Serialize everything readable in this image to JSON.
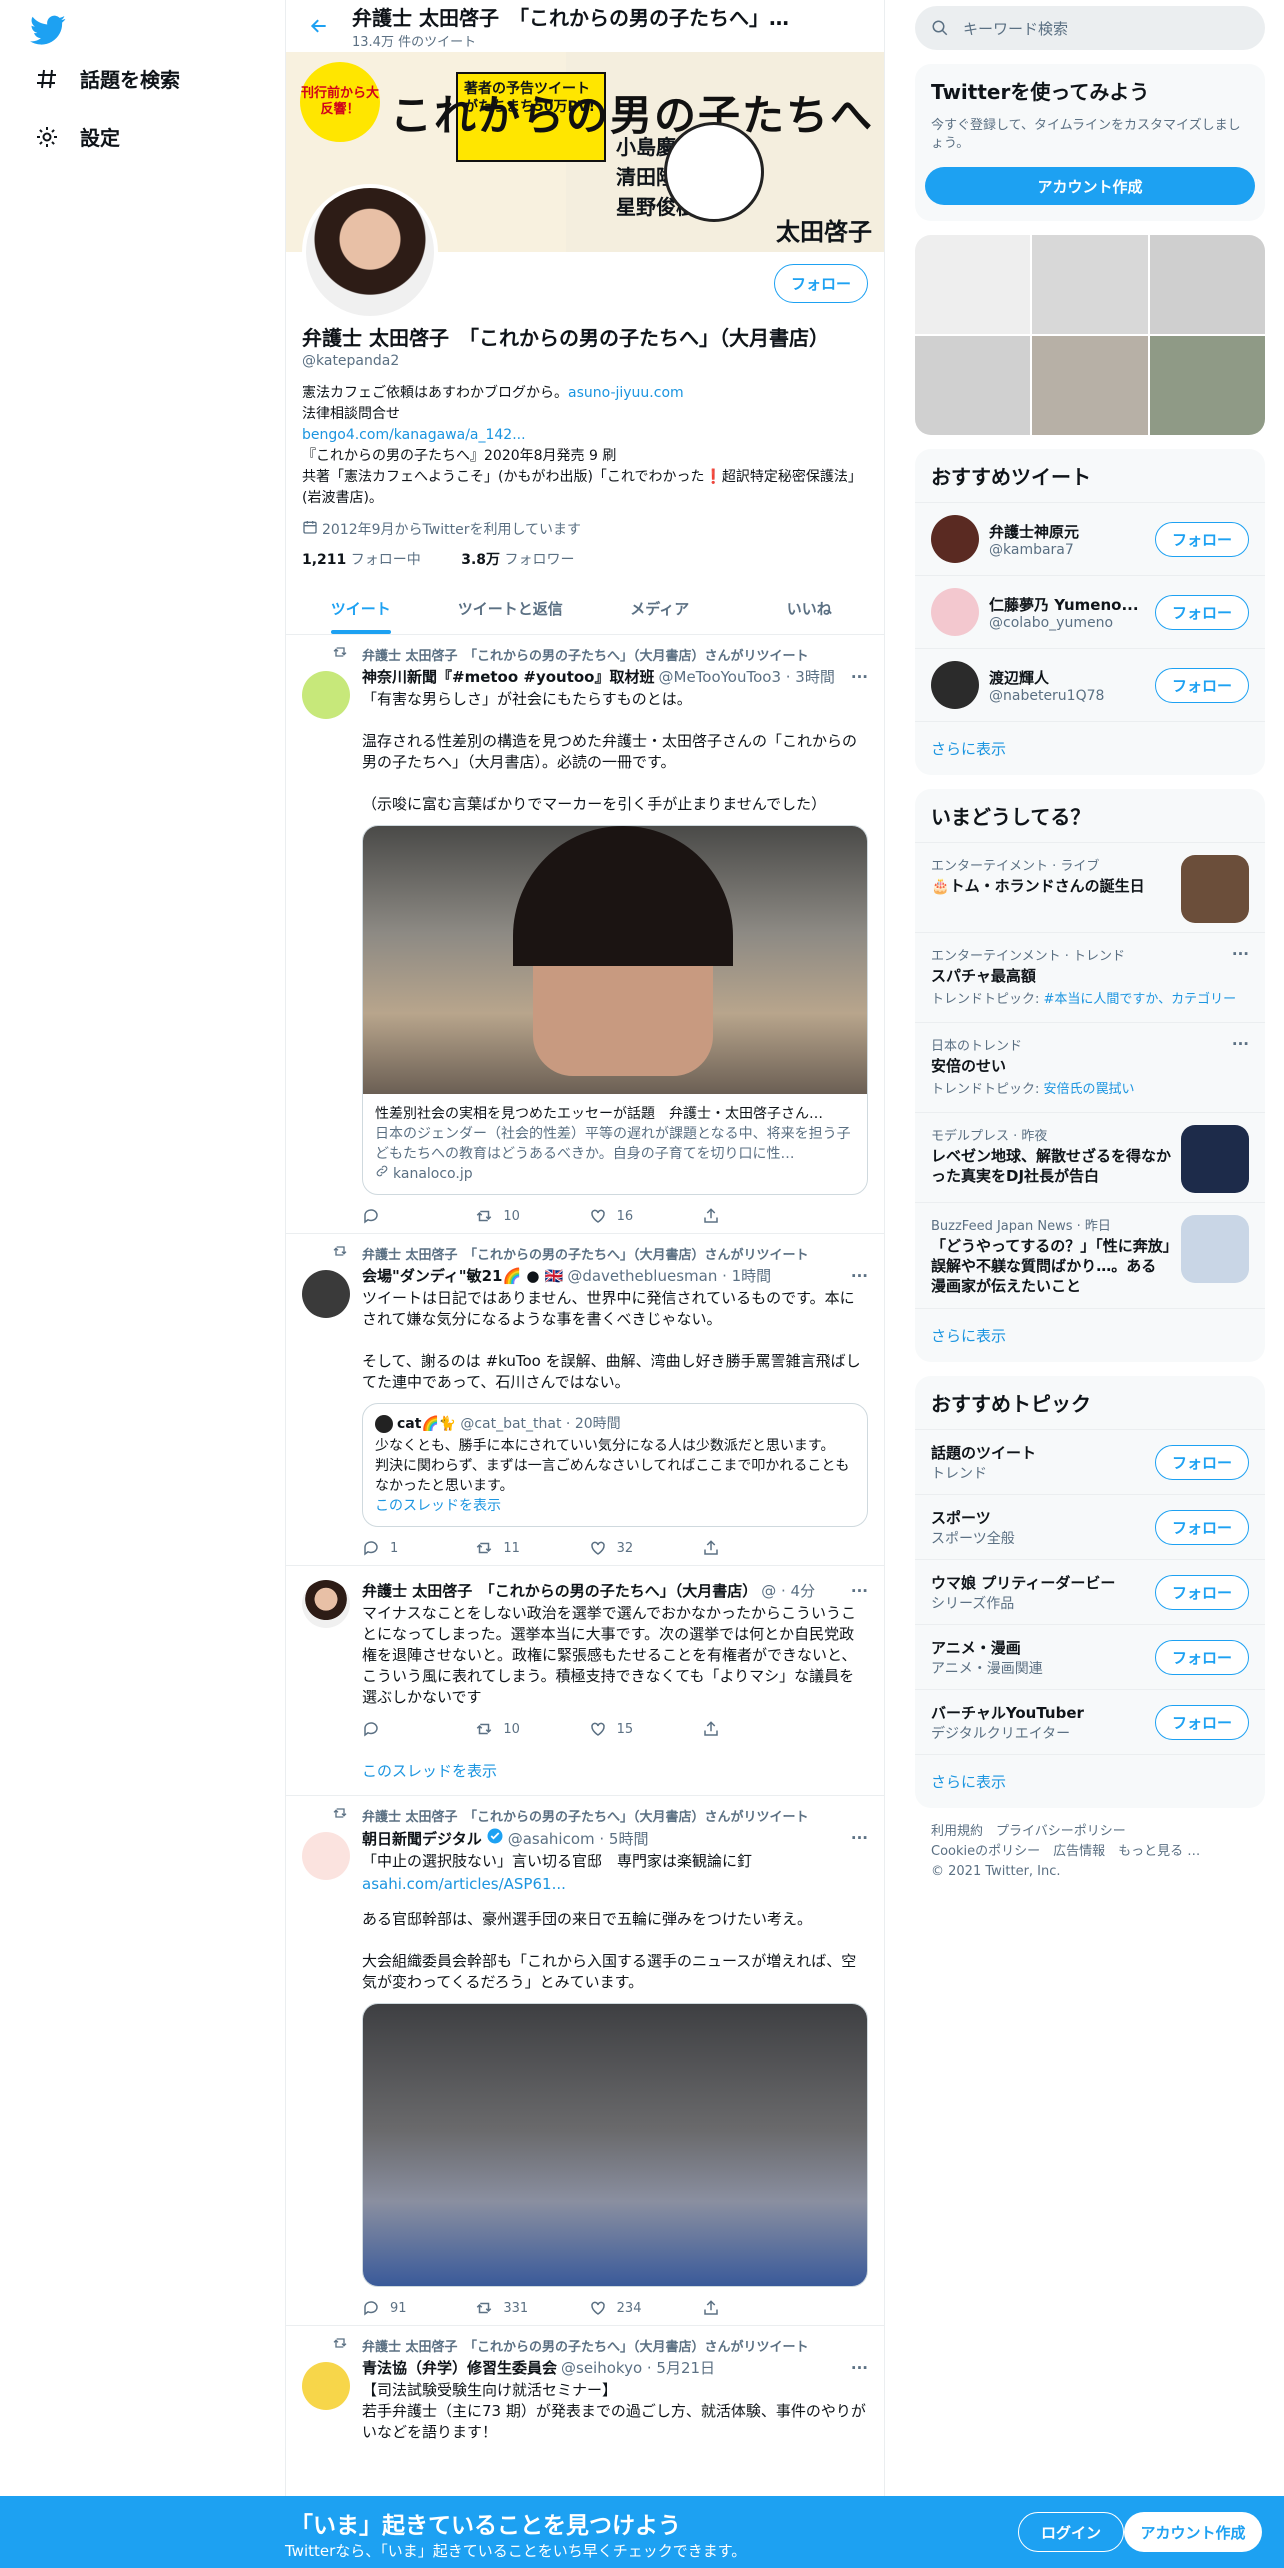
{
  "colors": {
    "accent": "#1da1f2",
    "text": "#0f1419",
    "secondary": "#5b7083",
    "bottom_bar": "#1da1f2"
  },
  "left_nav": {
    "items": [
      {
        "icon": "hashtag-icon",
        "label": "話題を検索"
      },
      {
        "icon": "gear-icon",
        "label": "設定"
      }
    ]
  },
  "header": {
    "title": "弁護士 太田啓子　「これからの男の子たちへ」…",
    "tweet_count": "13.4万 件のツイート"
  },
  "banner": {
    "big_title": "これからの男の子たちへ",
    "badge": "刊行前から大反響！",
    "box_note": "著者の予告ツイートがたちまち50万PV!",
    "names": [
      "小島慶子",
      "清田隆之",
      "星野俊樹"
    ],
    "author": "太田啓子"
  },
  "profile": {
    "follow_label": "フォロー",
    "name": "弁護士 太田啓子　「これからの男の子たちへ」（大月書店）",
    "handle": "@katepanda2",
    "bio_line1": "憲法カフェご依頼はあすわかブログから。",
    "bio_link1": "asuno-jiyuu.com",
    "bio_line2": "法律相談問合せ",
    "bio_link2": "bengo4.com/kanagawa/a_142...",
    "bio_line3": "『これからの男の子たちへ』2020年8月発売  9 刷",
    "bio_line4": "共著「憲法カフェへようこそ」(かもがわ出版)「これでわかった❗超訳特定秘密保護法」(岩波書店)。",
    "joined": "2012年9月からTwitterを利用しています",
    "following_count": "1,211",
    "following_label": "フォロー中",
    "followers_count": "3.8万",
    "followers_label": "フォロワー"
  },
  "tabs": [
    "ツイート",
    "ツイートと返信",
    "メディア",
    "いいね"
  ],
  "tweets": [
    {
      "retweet_by": "弁護士 太田啓子　「これからの男の子たちへ」（大月書店）さんがリツイート",
      "name": "神奈川新聞『#metoo #youtoo』取材班",
      "handle": "@MeTooYouToo3 · 3時間",
      "body": "「有害な男らしさ」が社会にもたらすものとは。\n\n温存される性差別の構造を見つめた弁護士・太田啓子さんの「これからの男の子たちへ」（大月書店）。必読の一冊です。\n\n（示唆に富む言葉ばかりでマーカーを引く手が止まりませんでした）",
      "card_title": "性差別社会の実相を見つめたエッセーが話題　弁護士・太田啓子さん…",
      "card_desc": "日本のジェンダー（社会的性差）平等の遅れが課題となる中、将来を担う子どもたちへの教育はどうあるべきか。自身の子育てを切り口に性…",
      "card_domain": "kanaloco.jp",
      "replies": "",
      "retweets": "10",
      "likes": "16"
    },
    {
      "retweet_by": "弁護士 太田啓子　「これからの男の子たちへ」（大月書店）さんがリツイート",
      "name": "会場\"ダンディ\"敏21🌈 ● 🇬🇧",
      "handle": "@davethebluesman · 1時間",
      "body": "ツイートは日記ではありません、世界中に発信されているものです。本にされて嫌な気分になるような事を書くべきじゃない。\n\nそして、謝るのは #kuToo を誤解、曲解、湾曲し好き勝手罵詈雑言飛ばしてた連中であって、石川さんではない。",
      "quote_name": "cat🌈🐈",
      "quote_handle": "@cat_bat_that · 20時間",
      "quote_body": "少なくとも、勝手に本にされていい気分になる人は少数派だと思います。\n判決に関わらず、まずは一言ごめんなさいしてればここまで叩かれることもなかったと思います。",
      "quote_thread": "このスレッドを表示",
      "replies": "1",
      "retweets": "11",
      "likes": "32"
    },
    {
      "name": "弁護士 太田啓子　「これからの男の子たちへ」（大月書店）",
      "handle": "@ · 4分",
      "body": "マイナスなことをしない政治を選挙で選んでおかなかったからこういうことになってしまった。選挙本当に大事です。次の選挙では何とか自民党政権を退陣させないと。政権に緊張感もたせることを有権者ができないと、こういう風に表れてしまう。積極支持できなくても「よりマシ」な議員を選ぶしかないです",
      "replies": "",
      "retweets": "10",
      "likes": "15",
      "thread_link": "このスレッドを表示"
    },
    {
      "retweet_by": "弁護士 太田啓子　「これからの男の子たちへ」（大月書店）さんがリツイート",
      "name": "朝日新聞デジタル",
      "handle": "@asahicom · 5時間",
      "body": "「中止の選択肢ない」言い切る官邸　専門家は楽観論に釘",
      "link": "asahi.com/articles/ASP61...",
      "body2": "ある官邸幹部は、豪州選手団の来日で五輪に弾みをつけたい考え。\n\n大会組織委員会幹部も「これから入国する選手のニュースが増えれば、空気が変わってくるだろう」とみています。",
      "replies": "91",
      "retweets": "331",
      "likes": "234"
    },
    {
      "retweet_by": "弁護士 太田啓子　「これからの男の子たちへ」（大月書店）さんがリツイート",
      "name": "青法協（弁学）修習生委員会",
      "handle": "@seihokyo · 5月21日",
      "body": "【司法試験受験生向け就活セミナー】\n若手弁護士（主に73 期）が発表までの過ごし方、就活体験、事件のやりがいなどを語ります！"
    }
  ],
  "right": {
    "search_placeholder": "キーワード検索",
    "try_title": "Twitterを使ってみよう",
    "try_sub": "今すぐ登録して、タイムラインをカスタマイズしましょう。",
    "try_button": "アカウント作成",
    "who_title": "おすすめツイート",
    "who": [
      {
        "name": "弁護士神原元",
        "handle": "@kambara7"
      },
      {
        "name": "仁藤夢乃 Yumeno...",
        "handle": "@colabo_yumeno"
      },
      {
        "name": "渡辺輝人",
        "handle": "@nabeteru1Q78"
      }
    ],
    "who_more": "さらに表示",
    "trends_title": "いまどうしてる？",
    "trends": [
      {
        "context": "エンターテイメント · ライブ",
        "title": "🎂トム・ホランドさんの誕生日"
      },
      {
        "context": "エンターテインメント · トレンド",
        "title": "スパチャ最高額",
        "topic_prefix": "トレンドトピック: ",
        "topic": "#本当に人間ですか、カテゴリー"
      },
      {
        "context": "日本のトレンド",
        "title": "安倍のせい",
        "topic_prefix": "トレンドトピック: ",
        "topic": "安倍氏の罠拭い"
      },
      {
        "context": "モデルプレス · 昨夜",
        "title": "レベゼン地球、解散せざるを得なかった真実をDJ社長が告白"
      },
      {
        "context": "BuzzFeed Japan News · 昨日",
        "title": "「どうやってするの？」「性に奔放」誤解や不躾な質問ばかり…。ある漫画家が伝えたいこと"
      }
    ],
    "trends_more": "さらに表示",
    "topics_title": "おすすめトピック",
    "topics": [
      {
        "name": "話題のツイート",
        "sub": "トレンド"
      },
      {
        "name": "スポーツ",
        "sub": "スポーツ全般"
      },
      {
        "name": "ウマ娘 プリティーダービー",
        "sub": "シリーズ作品"
      },
      {
        "name": "アニメ・漫画",
        "sub": "アニメ・漫画関連"
      },
      {
        "name": "バーチャルYouTuber",
        "sub": "デジタルクリエイター"
      }
    ],
    "topics_more": "さらに表示",
    "footer_line1": "利用規約　プライバシーポリシー",
    "footer_line2": "Cookieのポリシー　広告情報　もっと見る …",
    "footer_line3": "© 2021 Twitter, Inc."
  },
  "bottom_bar": {
    "headline": "「いま」起きていることを見つけよう",
    "sub": "Twitterなら、「いま」起きていることをいち早くチェックできます。",
    "login": "ログイン",
    "signup": "アカウント作成"
  }
}
